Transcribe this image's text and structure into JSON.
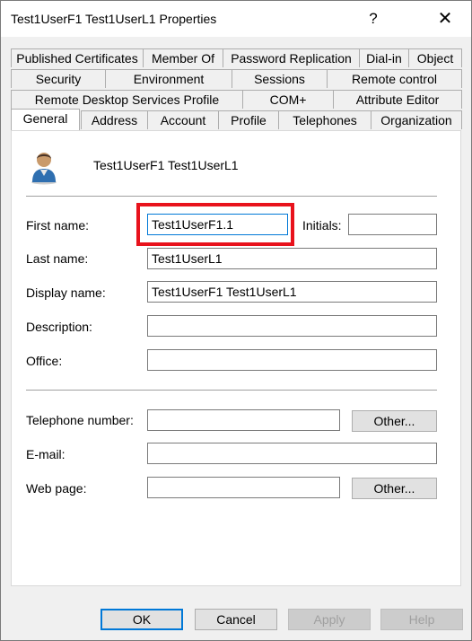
{
  "window": {
    "title": "Test1UserF1 Test1UserL1 Properties",
    "help": "?",
    "close": "✕"
  },
  "tabs": {
    "row1": [
      "Published Certificates",
      "Member Of",
      "Password Replication",
      "Dial-in",
      "Object"
    ],
    "row2": [
      "Security",
      "Environment",
      "Sessions",
      "Remote control"
    ],
    "row3": [
      "Remote Desktop Services Profile",
      "COM+",
      "Attribute Editor"
    ],
    "row4": [
      "General",
      "Address",
      "Account",
      "Profile",
      "Telephones",
      "Organization"
    ],
    "active": "General"
  },
  "general": {
    "header_name": "Test1UserF1 Test1UserL1",
    "first_name": {
      "label": "First name:",
      "value": "Test1UserF1.1"
    },
    "initials": {
      "label": "Initials:",
      "value": ""
    },
    "last_name": {
      "label": "Last name:",
      "value": "Test1UserL1"
    },
    "display_name": {
      "label": "Display name:",
      "value": "Test1UserF1 Test1UserL1"
    },
    "description": {
      "label": "Description:",
      "value": ""
    },
    "office": {
      "label": "Office:",
      "value": ""
    },
    "telephone": {
      "label": "Telephone number:",
      "value": "",
      "other": "Other..."
    },
    "email": {
      "label": "E-mail:",
      "value": ""
    },
    "web_page": {
      "label": "Web page:",
      "value": "",
      "other": "Other..."
    }
  },
  "footer": {
    "ok": "OK",
    "cancel": "Cancel",
    "apply": "Apply",
    "help": "Help"
  },
  "colors": {
    "highlight": "#e8121c",
    "focus": "#0078d7"
  },
  "icons": {
    "user": "user-icon"
  }
}
